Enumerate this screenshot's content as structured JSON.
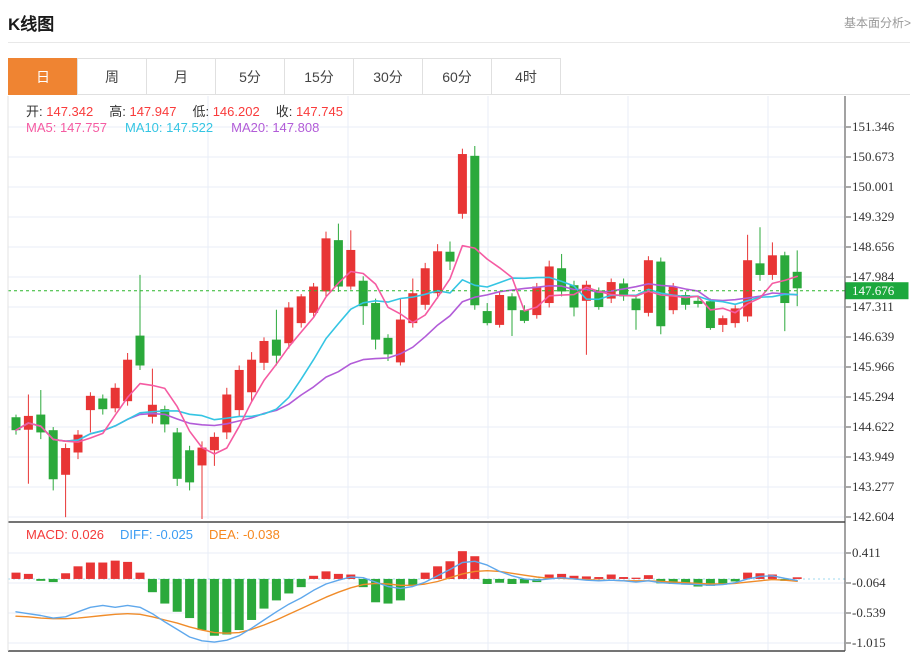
{
  "header": {
    "title": "K线图",
    "link_label": "基本面分析>"
  },
  "tabs": {
    "items": [
      "日",
      "周",
      "月",
      "5分",
      "15分",
      "30分",
      "60分",
      "4时"
    ],
    "active_index": 0
  },
  "ohlc_bar": {
    "items": [
      {
        "label": "开",
        "value": "147.342"
      },
      {
        "label": "高",
        "value": "147.947"
      },
      {
        "label": "低",
        "value": "146.202"
      },
      {
        "label": "收",
        "value": "147.745"
      }
    ]
  },
  "ma_bar": {
    "items": [
      {
        "label": "MA5",
        "value": "147.757",
        "color": "#f55ba2"
      },
      {
        "label": "MA10",
        "value": "147.522",
        "color": "#35c5e3"
      },
      {
        "label": "MA20",
        "value": "147.808",
        "color": "#b25cd8"
      }
    ]
  },
  "macd_bar": {
    "items": [
      {
        "label": "MACD",
        "value": "0.026",
        "color": "#f43b3b"
      },
      {
        "label": "DIFF",
        "value": "-0.025",
        "color": "#3d9df3"
      },
      {
        "label": "DEA",
        "value": "-0.038",
        "color": "#f6881f"
      }
    ]
  },
  "chart_data": [
    {
      "type": "candlestick",
      "title": "K线图 日K",
      "legend": [
        "MA5",
        "MA10",
        "MA20"
      ],
      "ma_periods": [
        5,
        10,
        20
      ],
      "y_tick_labels": [
        "151.346",
        "150.673",
        "150.001",
        "149.329",
        "148.656",
        "147.984",
        "147.311",
        "146.639",
        "145.966",
        "145.294",
        "144.622",
        "143.949",
        "143.277",
        "142.604"
      ],
      "y_range": [
        142.604,
        151.346
      ],
      "last_price": 147.676,
      "last_price_label": "147.676",
      "grid": true,
      "colors": {
        "up": "#e83535",
        "down": "#2ba93b",
        "ma5": "#f55ba2",
        "ma10": "#35c5e3",
        "ma20": "#b25cd8",
        "last_price_line": "#2cb52c",
        "last_price_tag": "#1ca83d"
      },
      "candles": [
        [
          144.84,
          144.9,
          144.45,
          144.55
        ],
        [
          144.56,
          145.35,
          143.35,
          144.87
        ],
        [
          144.9,
          145.45,
          144.35,
          144.5
        ],
        [
          144.55,
          144.62,
          143.2,
          143.45
        ],
        [
          143.55,
          144.25,
          142.6,
          144.15
        ],
        [
          144.05,
          144.55,
          143.9,
          144.45
        ],
        [
          145.0,
          145.4,
          144.5,
          145.32
        ],
        [
          145.26,
          145.35,
          144.9,
          145.02
        ],
        [
          145.04,
          145.6,
          144.95,
          145.5
        ],
        [
          145.2,
          146.28,
          145.1,
          146.13
        ],
        [
          146.67,
          148.03,
          145.9,
          146.0
        ],
        [
          144.85,
          145.93,
          144.7,
          145.12
        ],
        [
          145.02,
          145.1,
          144.5,
          144.68
        ],
        [
          144.5,
          144.6,
          143.3,
          143.46
        ],
        [
          144.1,
          144.2,
          143.2,
          143.38
        ],
        [
          143.76,
          144.3,
          142.56,
          144.16
        ],
        [
          144.1,
          144.5,
          143.75,
          144.4
        ],
        [
          144.5,
          145.5,
          144.35,
          145.35
        ],
        [
          145.0,
          146.0,
          144.85,
          145.9
        ],
        [
          145.4,
          146.3,
          145.2,
          146.13
        ],
        [
          146.06,
          146.63,
          145.9,
          146.55
        ],
        [
          146.58,
          147.25,
          146.0,
          146.22
        ],
        [
          146.5,
          147.42,
          146.38,
          147.3
        ],
        [
          146.95,
          147.6,
          146.85,
          147.55
        ],
        [
          147.18,
          147.85,
          147.1,
          147.77
        ],
        [
          147.66,
          149.0,
          147.55,
          148.85
        ],
        [
          148.81,
          149.18,
          147.65,
          147.77
        ],
        [
          147.77,
          149.03,
          147.7,
          148.59
        ],
        [
          147.9,
          148.0,
          146.91,
          147.33
        ],
        [
          147.4,
          147.5,
          146.36,
          146.58
        ],
        [
          146.62,
          146.7,
          146.1,
          146.25
        ],
        [
          146.07,
          147.5,
          146.0,
          147.03
        ],
        [
          146.95,
          147.95,
          146.85,
          147.62
        ],
        [
          147.36,
          148.3,
          147.25,
          148.18
        ],
        [
          147.62,
          148.72,
          147.5,
          148.56
        ],
        [
          148.55,
          148.78,
          148.14,
          148.33
        ],
        [
          149.4,
          150.86,
          149.29,
          150.74
        ],
        [
          150.7,
          150.92,
          147.25,
          147.35
        ],
        [
          147.22,
          147.4,
          146.9,
          146.95
        ],
        [
          146.91,
          147.65,
          146.85,
          147.58
        ],
        [
          147.55,
          147.62,
          146.66,
          147.24
        ],
        [
          147.24,
          147.35,
          146.95,
          147.0
        ],
        [
          147.13,
          147.85,
          147.05,
          147.77
        ],
        [
          147.4,
          148.35,
          147.3,
          148.22
        ],
        [
          148.18,
          148.5,
          147.55,
          147.66
        ],
        [
          147.8,
          147.9,
          147.1,
          147.3
        ],
        [
          147.45,
          147.9,
          146.24,
          147.81
        ],
        [
          147.68,
          147.75,
          147.25,
          147.31
        ],
        [
          147.5,
          147.95,
          147.4,
          147.87
        ],
        [
          147.84,
          147.95,
          147.45,
          147.55
        ],
        [
          147.5,
          147.56,
          146.8,
          147.24
        ],
        [
          147.18,
          148.45,
          147.1,
          148.36
        ],
        [
          148.33,
          148.42,
          146.7,
          146.88
        ],
        [
          147.24,
          147.85,
          147.15,
          147.77
        ],
        [
          147.58,
          147.65,
          147.25,
          147.36
        ],
        [
          147.45,
          147.55,
          147.3,
          147.38
        ],
        [
          147.44,
          147.5,
          146.8,
          146.84
        ],
        [
          146.91,
          147.12,
          146.75,
          147.06
        ],
        [
          146.95,
          147.35,
          146.85,
          147.28
        ],
        [
          147.1,
          148.93,
          146.98,
          148.36
        ],
        [
          148.29,
          149.1,
          147.9,
          148.03
        ],
        [
          148.03,
          148.76,
          147.92,
          148.47
        ],
        [
          148.47,
          148.55,
          146.77,
          147.4
        ],
        [
          148.1,
          148.58,
          147.33,
          147.73
        ]
      ]
    },
    {
      "type": "bar",
      "title": "MACD(12,26,9)",
      "y_tick_labels": [
        "0.411",
        "-0.064",
        "-0.539",
        "-1.015"
      ],
      "y_ticks": [
        0.411,
        -0.064,
        -0.539,
        -1.015
      ],
      "colors": {
        "pos": "#e83535",
        "neg": "#2ba93b",
        "diff": "#5fa8ec",
        "dea": "#f08c2a",
        "zero_line": "#9fd8ef"
      },
      "hist": [
        0.1,
        0.08,
        -0.03,
        -0.05,
        0.09,
        0.2,
        0.26,
        0.26,
        0.29,
        0.27,
        0.1,
        -0.21,
        -0.39,
        -0.52,
        -0.62,
        -0.81,
        -0.9,
        -0.88,
        -0.81,
        -0.65,
        -0.47,
        -0.34,
        -0.23,
        -0.13,
        0.05,
        0.12,
        0.08,
        0.07,
        -0.13,
        -0.37,
        -0.39,
        -0.34,
        -0.1,
        0.1,
        0.2,
        0.28,
        0.44,
        0.36,
        -0.08,
        -0.06,
        -0.08,
        -0.07,
        -0.05,
        0.07,
        0.08,
        0.05,
        0.04,
        0.03,
        0.07,
        0.03,
        0.02,
        0.06,
        -0.07,
        -0.08,
        -0.09,
        -0.12,
        -0.11,
        -0.09,
        -0.04,
        0.1,
        0.09,
        0.07,
        -0.03,
        0.026
      ],
      "diff": [
        -0.52,
        -0.55,
        -0.58,
        -0.62,
        -0.6,
        -0.52,
        -0.45,
        -0.42,
        -0.45,
        -0.42,
        -0.45,
        -0.55,
        -0.68,
        -0.8,
        -0.92,
        -0.98,
        -1.0,
        -0.97,
        -0.9,
        -0.78,
        -0.65,
        -0.52,
        -0.4,
        -0.3,
        -0.18,
        -0.08,
        -0.02,
        0.03,
        0.02,
        -0.05,
        -0.12,
        -0.15,
        -0.12,
        -0.05,
        0.05,
        0.15,
        0.26,
        0.28,
        0.22,
        0.12,
        0.05,
        0.0,
        -0.02,
        0.0,
        0.02,
        0.0,
        -0.02,
        -0.03,
        -0.02,
        -0.03,
        -0.05,
        -0.03,
        -0.06,
        -0.07,
        -0.08,
        -0.09,
        -0.1,
        -0.09,
        -0.06,
        0.0,
        0.04,
        0.05,
        0.01,
        -0.025
      ],
      "dea": [
        -0.59,
        -0.6,
        -0.62,
        -0.63,
        -0.63,
        -0.62,
        -0.6,
        -0.58,
        -0.56,
        -0.55,
        -0.56,
        -0.6,
        -0.65,
        -0.7,
        -0.76,
        -0.81,
        -0.85,
        -0.86,
        -0.85,
        -0.8,
        -0.73,
        -0.65,
        -0.56,
        -0.47,
        -0.38,
        -0.29,
        -0.21,
        -0.14,
        -0.09,
        -0.07,
        -0.08,
        -0.1,
        -0.1,
        -0.08,
        -0.04,
        0.02,
        0.08,
        0.12,
        0.13,
        0.12,
        0.09,
        0.06,
        0.03,
        0.01,
        0.01,
        0.0,
        -0.01,
        -0.02,
        -0.02,
        -0.03,
        -0.03,
        -0.03,
        -0.04,
        -0.05,
        -0.06,
        -0.07,
        -0.08,
        -0.08,
        -0.07,
        -0.05,
        -0.03,
        -0.01,
        -0.02,
        -0.038
      ]
    }
  ]
}
